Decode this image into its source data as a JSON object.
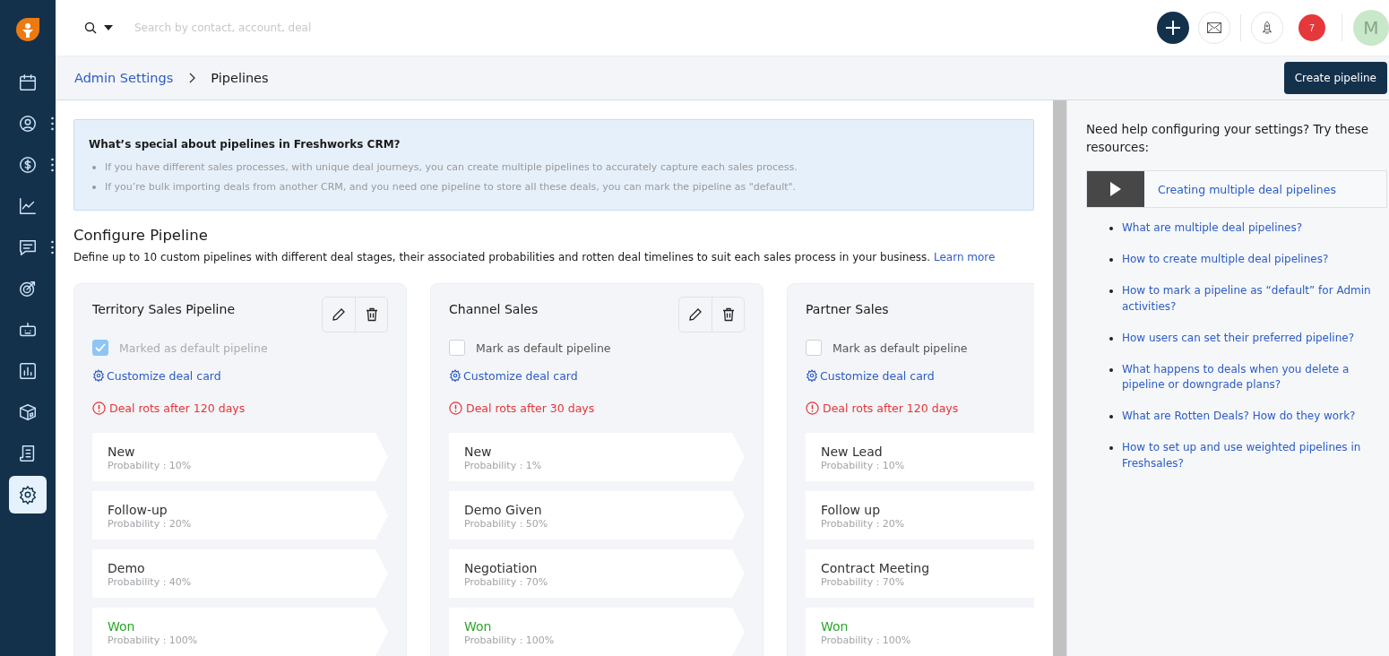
{
  "sidebar": {
    "items": [
      {
        "selected": false,
        "more": false
      },
      {
        "selected": false,
        "more": true
      },
      {
        "selected": false,
        "more": true
      },
      {
        "selected": false,
        "more": false
      },
      {
        "selected": false,
        "more": true
      },
      {
        "selected": false,
        "more": false
      },
      {
        "selected": false,
        "more": false
      },
      {
        "selected": false,
        "more": false
      },
      {
        "selected": false,
        "more": false
      },
      {
        "selected": false,
        "more": false
      },
      {
        "selected": true,
        "more": false
      }
    ]
  },
  "search": {
    "placeholder": "Search by contact, account, deal"
  },
  "header": {
    "notifications": "7",
    "avatar": "M"
  },
  "breadcrumb": {
    "parent": "Admin Settings",
    "current": "Pipelines"
  },
  "create_button": "Create pipeline",
  "info": {
    "title": "What’s special about pipelines in Freshworks CRM?",
    "points": [
      "If you have different sales processes, with unique deal journeys, you can create multiple pipelines to accurately capture each sales process.",
      "If you’re bulk importing deals from another CRM, and you need one pipeline to store all these deals, you can mark the pipeline as \"default\"."
    ]
  },
  "configure": {
    "title": "Configure Pipeline",
    "description": "Define up to 10 custom pipelines with different deal stages, their associated probabilities and rotten deal timelines to suit each sales process in your business.",
    "link": "Learn more"
  },
  "pipelines": [
    {
      "name": "Territory Sales Pipeline",
      "default_label": "Marked as default pipeline",
      "checked": true,
      "customize": "Customize deal card",
      "rot": "Deal rots after 120 days",
      "stages": [
        {
          "name": "New",
          "probability": "Probability : 10%",
          "kind": "open"
        },
        {
          "name": "Follow-up",
          "probability": "Probability : 20%",
          "kind": "open"
        },
        {
          "name": "Demo",
          "probability": "Probability : 40%",
          "kind": "open"
        },
        {
          "name": "Won",
          "probability": "Probability : 100%",
          "kind": "won"
        }
      ]
    },
    {
      "name": "Channel Sales",
      "default_label": "Mark as default pipeline",
      "checked": false,
      "customize": "Customize deal card",
      "rot": "Deal rots after 30 days",
      "stages": [
        {
          "name": "New",
          "probability": "Probability : 1%",
          "kind": "open"
        },
        {
          "name": "Demo Given",
          "probability": "Probability : 50%",
          "kind": "open"
        },
        {
          "name": "Negotiation",
          "probability": "Probability : 70%",
          "kind": "open"
        },
        {
          "name": "Won",
          "probability": "Probability : 100%",
          "kind": "won"
        }
      ]
    },
    {
      "name": "Partner Sales",
      "default_label": "Mark as default pipeline",
      "checked": false,
      "customize": "Customize deal card",
      "rot": "Deal rots after 120 days",
      "stages": [
        {
          "name": "New Lead",
          "probability": "Probability : 10%",
          "kind": "open"
        },
        {
          "name": "Follow up",
          "probability": "Probability : 20%",
          "kind": "open"
        },
        {
          "name": "Contract Meeting",
          "probability": "Probability : 70%",
          "kind": "open"
        },
        {
          "name": "Won",
          "probability": "Probability : 100%",
          "kind": "won"
        }
      ]
    }
  ],
  "help": {
    "title": "Need help configuring your settings? Try these resources:",
    "video": "Creating multiple deal pipelines",
    "links": [
      "What are multiple deal pipelines?",
      "How to create multiple deal pipelines?",
      "How to mark a pipeline as “default” for Admin activities?",
      "How users can set their preferred pipeline?",
      "What happens to deals when you delete a pipeline or downgrade plans?",
      "What are Rotten Deals? How do they work?",
      "How to set up and use weighted pipelines in Freshsales?"
    ]
  }
}
